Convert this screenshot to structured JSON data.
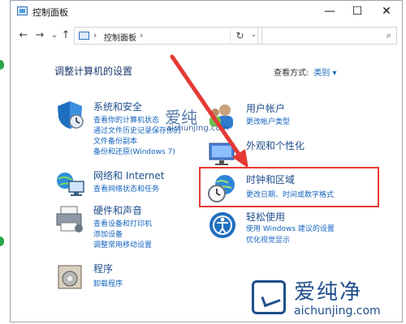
{
  "window": {
    "title": "控制面板",
    "controls": {
      "minimize": "—",
      "maximize": "☐",
      "close": "✕"
    }
  },
  "nav": {
    "back": "←",
    "forward": "→",
    "dropdown": "⌄",
    "up": "↑",
    "address_sep": "›",
    "address_crumb": "控制面板",
    "crumb_sep": "›",
    "address_dd": "⌄",
    "refresh": "↻",
    "search_placeholder": "",
    "search_icon": "⌕"
  },
  "main": {
    "heading": "调整计算机的设置",
    "view_by_label": "查看方式:",
    "view_by_value": "类别 ▾"
  },
  "categories_left": [
    {
      "title": "系统和安全",
      "icon": "shield-icon",
      "links": [
        "查看你的计算机状态",
        "通过文件历史记录保存你的",
        "文件备份副本",
        "备份和还原(Windows 7)"
      ]
    },
    {
      "title": "网络和 Internet",
      "icon": "network-icon",
      "links": [
        "查看网络状态和任务"
      ]
    },
    {
      "title": "硬件和声音",
      "icon": "printer-icon",
      "links": [
        "查看设备和打印机",
        "添加设备",
        "调整常用移动设置"
      ]
    },
    {
      "title": "程序",
      "icon": "programs-icon",
      "links": [
        "卸载程序"
      ]
    }
  ],
  "categories_right": [
    {
      "title": "用户帐户",
      "icon": "users-icon",
      "links": [
        "更改帐户类型"
      ]
    },
    {
      "title": "外观和个性化",
      "icon": "appearance-icon",
      "links": []
    },
    {
      "title": "时钟和区域",
      "icon": "clock-globe-icon",
      "links": [
        "更改日期、时间或数字格式"
      ]
    },
    {
      "title": "轻松使用",
      "icon": "ease-of-access-icon",
      "links": [
        "使用 Windows 建议的设置",
        "优化视觉显示"
      ]
    }
  ],
  "watermark": {
    "mid_text": "爱纯",
    "mid_url": "aichunjing.com",
    "brand": "爱纯净",
    "url": "aichunjing.com"
  },
  "colors": {
    "link": "#1565c0",
    "title": "#1f4e8c",
    "highlight": "#e53935"
  }
}
